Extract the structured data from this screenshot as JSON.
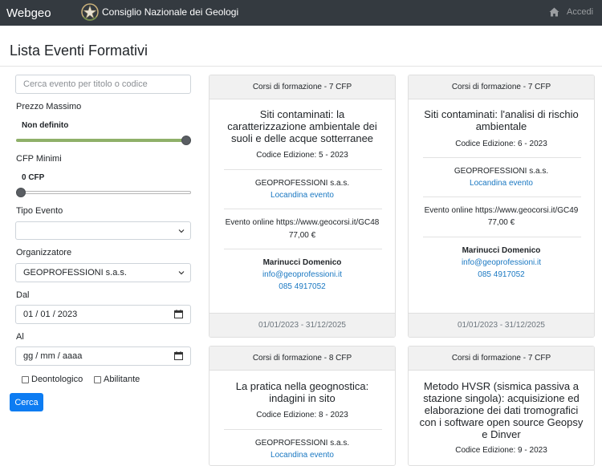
{
  "navbar": {
    "brand": "Webgeo",
    "org_name": "Consiglio Nazionale dei Geologi",
    "login_label": "Accedi"
  },
  "page_title": "Lista Eventi Formativi",
  "filters": {
    "search_placeholder": "Cerca evento per titolo o codice",
    "prezzo_label": "Prezzo Massimo",
    "prezzo_value": "Non definito",
    "prezzo_level": 1.0,
    "cfp_label": "CFP Minimi",
    "cfp_value": "0 CFP",
    "cfp_level": 0.0,
    "tipo_label": "Tipo Evento",
    "tipo_value": "",
    "organizzatore_label": "Organizzatore",
    "organizzatore_value": "GEOPROFESSIONI s.a.s.",
    "dal_label": "Dal",
    "dal_value": "01 / 01 / 2023",
    "al_label": "Al",
    "al_value": "gg / mm / aaaa",
    "deontologico_label": "Deontologico",
    "abilitante_label": "Abilitante",
    "cerca_label": "Cerca"
  },
  "cards": [
    {
      "header": "Corsi di formazione - 7 CFP",
      "title": "Siti contaminati: la caratterizzazione ambientale dei suoli e delle acque sotterranee",
      "code": "Codice Edizione: 5 - 2023",
      "organizer": "GEOPROFESSIONI s.a.s.",
      "flyer": "Locandina evento",
      "location": "Evento online https://www.geocorsi.it/GC48",
      "price": "77,00 €",
      "contact_name": "Marinucci Domenico",
      "contact_email": "info@geoprofessioni.it",
      "contact_phone": "085 4917052",
      "dates": "01/01/2023 - 31/12/2025"
    },
    {
      "header": "Corsi di formazione - 7 CFP",
      "title": "Siti contaminati: l'analisi di rischio ambientale",
      "code": "Codice Edizione: 6 - 2023",
      "organizer": "GEOPROFESSIONI s.a.s.",
      "flyer": "Locandina evento",
      "location": "Evento online https://www.geocorsi.it/GC49",
      "price": "77,00 €",
      "contact_name": "Marinucci Domenico",
      "contact_email": "info@geoprofessioni.it",
      "contact_phone": "085 4917052",
      "dates": "01/01/2023 - 31/12/2025"
    },
    {
      "header": "Corsi di formazione - 8 CFP",
      "title": "La pratica nella geognostica: indagini in sito",
      "code": "Codice Edizione: 8 - 2023",
      "organizer": "GEOPROFESSIONI s.a.s.",
      "flyer": "Locandina evento"
    },
    {
      "header": "Corsi di formazione - 7 CFP",
      "title": "Metodo HVSR (sismica passiva a stazione singola): acquisizione ed elaborazione dei dati tromografici con i software open source Geopsy e Dinver",
      "code": "Codice Edizione: 9 - 2023"
    }
  ],
  "colors": {
    "navbar": "#343a40",
    "primary": "#0d7cf2",
    "slider_fill": "#8fb069",
    "link": "#1a78c2"
  }
}
